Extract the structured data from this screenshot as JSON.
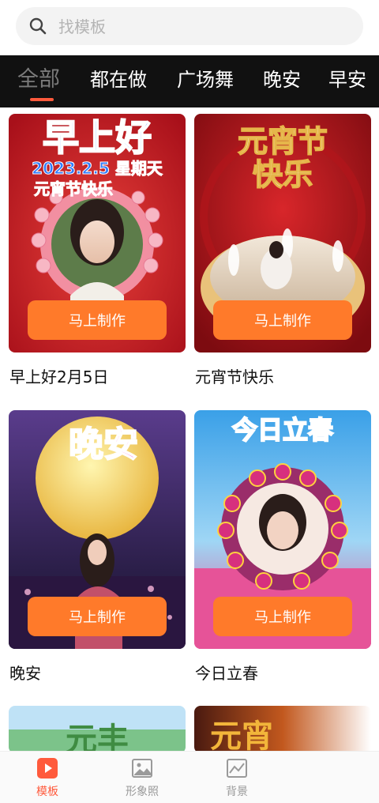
{
  "search": {
    "placeholder": "找模板"
  },
  "tabs": [
    {
      "label": "全部",
      "active": true
    },
    {
      "label": "都在做",
      "active": false
    },
    {
      "label": "广场舞",
      "active": false
    },
    {
      "label": "晚安",
      "active": false
    },
    {
      "label": "早安",
      "active": false
    }
  ],
  "templates": [
    {
      "title": "早上好2月5日",
      "button": "马上制作",
      "art_text": {
        "headline": "早上好",
        "date_line": "2023.2.5 星期天",
        "sub_line": "元宵节快乐"
      }
    },
    {
      "title": "元宵节快乐",
      "button": "马上制作",
      "art_text": {
        "headline_1": "元宵节",
        "headline_2": "快乐"
      }
    },
    {
      "title": "晚安",
      "button": "马上制作",
      "art_text": {
        "headline": "晚安"
      }
    },
    {
      "title": "今日立春",
      "button": "马上制作",
      "art_text": {
        "headline": "今日立春"
      }
    }
  ],
  "partial_cards": [
    {
      "art_text": "元丰"
    },
    {
      "art_text": "元宵"
    }
  ],
  "bottom_nav": [
    {
      "label": "模板",
      "icon": "play-icon",
      "active": true
    },
    {
      "label": "形象照",
      "icon": "image-icon",
      "active": false
    },
    {
      "label": "背景",
      "icon": "background-icon",
      "active": false
    }
  ],
  "colors": {
    "accent": "#ff5a3c",
    "button": "#ff7a2a",
    "tab_bar": "#111111"
  }
}
